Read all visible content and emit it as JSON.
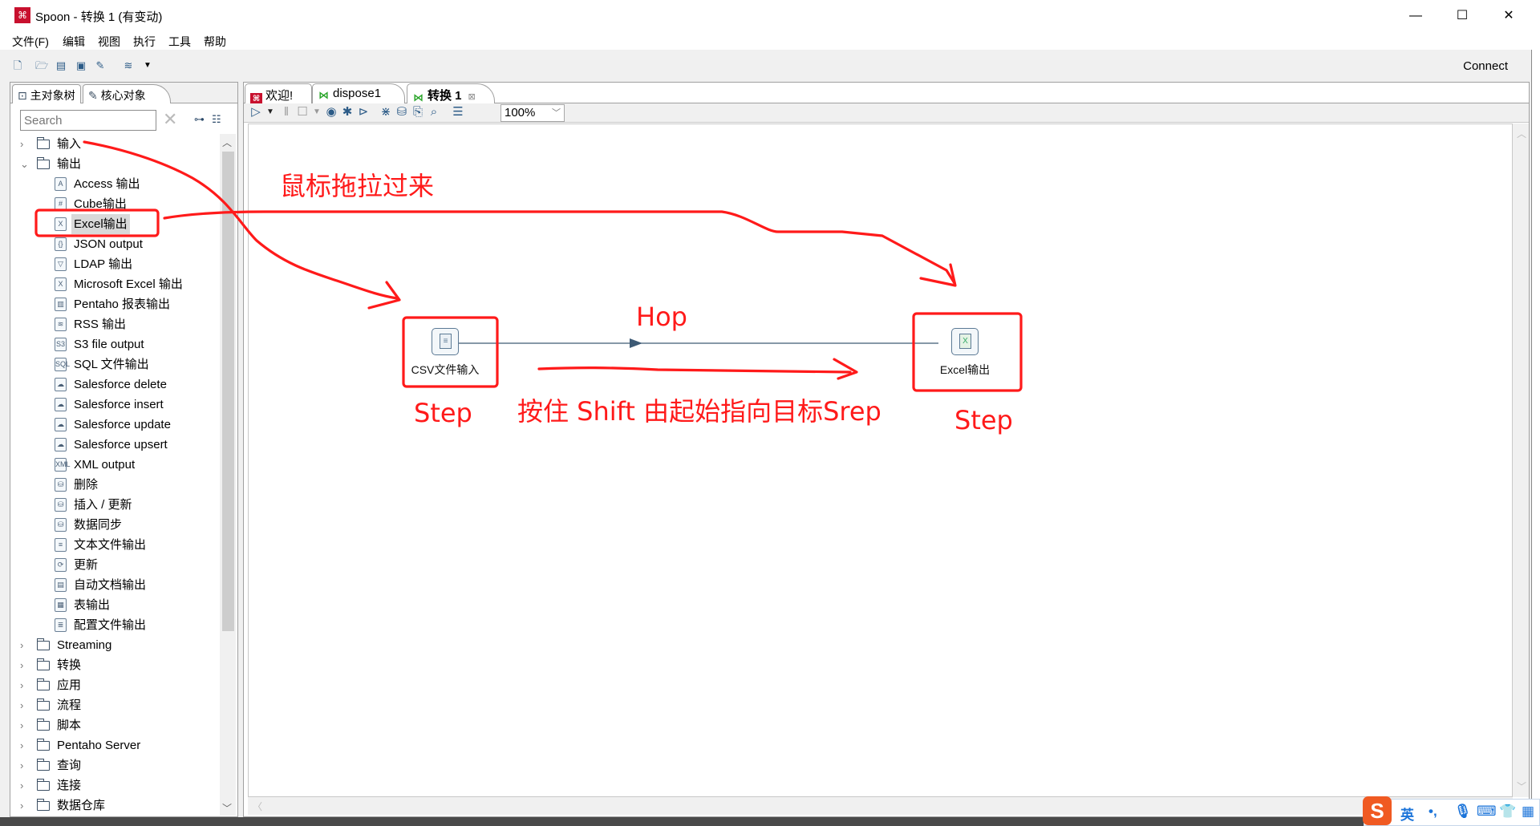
{
  "window": {
    "title": "Spoon - 转换 1 (有变动)",
    "app_icon": "spoon-logo-icon",
    "controls": {
      "minimize": "—",
      "maximize": "☐",
      "close": "✕"
    }
  },
  "menubar": {
    "items": [
      "文件(F)",
      "编辑",
      "视图",
      "执行",
      "工具",
      "帮助"
    ]
  },
  "toolbar": {
    "icons": [
      "new-file-icon",
      "open-file-icon",
      "explore-repository-icon",
      "save-icon",
      "save-as-icon",
      "perspective-layers-icon",
      "dropdown-arrow-icon"
    ],
    "connect_label": "Connect"
  },
  "left_panel": {
    "tabs": [
      {
        "label": "主对象树",
        "icon": "tree-icon",
        "active": false
      },
      {
        "label": "核心对象",
        "icon": "pencil-icon",
        "active": true
      }
    ],
    "search": {
      "placeholder": "Search",
      "value": ""
    },
    "tree": [
      {
        "label": "输入",
        "type": "folder",
        "expanded": false
      },
      {
        "label": "输出",
        "type": "folder",
        "expanded": true
      },
      {
        "label": "Access 输出",
        "type": "leaf",
        "icon": "A"
      },
      {
        "label": "Cube输出",
        "type": "leaf",
        "icon": "#"
      },
      {
        "label": "Excel输出",
        "type": "leaf",
        "icon": "X",
        "selected": true
      },
      {
        "label": "JSON output",
        "type": "leaf",
        "icon": "{}"
      },
      {
        "label": "LDAP 输出",
        "type": "leaf",
        "icon": "▽"
      },
      {
        "label": "Microsoft Excel 输出",
        "type": "leaf",
        "icon": "X"
      },
      {
        "label": "Pentaho 报表输出",
        "type": "leaf",
        "icon": "▥"
      },
      {
        "label": "RSS 输出",
        "type": "leaf",
        "icon": "≋"
      },
      {
        "label": "S3 file output",
        "type": "leaf",
        "icon": "S3"
      },
      {
        "label": "SQL 文件输出",
        "type": "leaf",
        "icon": "SQL"
      },
      {
        "label": "Salesforce delete",
        "type": "leaf",
        "icon": "☁"
      },
      {
        "label": "Salesforce insert",
        "type": "leaf",
        "icon": "☁"
      },
      {
        "label": "Salesforce update",
        "type": "leaf",
        "icon": "☁"
      },
      {
        "label": "Salesforce upsert",
        "type": "leaf",
        "icon": "☁"
      },
      {
        "label": "XML output",
        "type": "leaf",
        "icon": "XML"
      },
      {
        "label": "删除",
        "type": "leaf",
        "icon": "⛁"
      },
      {
        "label": "插入 / 更新",
        "type": "leaf",
        "icon": "⛁"
      },
      {
        "label": "数据同步",
        "type": "leaf",
        "icon": "⛁"
      },
      {
        "label": "文本文件输出",
        "type": "leaf",
        "icon": "≡"
      },
      {
        "label": "更新",
        "type": "leaf",
        "icon": "⟳"
      },
      {
        "label": "自动文档输出",
        "type": "leaf",
        "icon": "▤"
      },
      {
        "label": "表输出",
        "type": "leaf",
        "icon": "▦"
      },
      {
        "label": "配置文件输出",
        "type": "leaf",
        "icon": "≣"
      },
      {
        "label": "Streaming",
        "type": "folder",
        "expanded": false
      },
      {
        "label": "转换",
        "type": "folder",
        "expanded": false
      },
      {
        "label": "应用",
        "type": "folder",
        "expanded": false
      },
      {
        "label": "流程",
        "type": "folder",
        "expanded": false
      },
      {
        "label": "脚本",
        "type": "folder",
        "expanded": false
      },
      {
        "label": "Pentaho Server",
        "type": "folder",
        "expanded": false
      },
      {
        "label": "查询",
        "type": "folder",
        "expanded": false
      },
      {
        "label": "连接",
        "type": "folder",
        "expanded": false
      },
      {
        "label": "数据仓库",
        "type": "folder",
        "expanded": false
      }
    ]
  },
  "doc_tabs": [
    {
      "label": "欢迎!",
      "icon": "spoon-logo-icon",
      "active": false
    },
    {
      "label": "dispose1",
      "icon": "transformation-icon",
      "active": false
    },
    {
      "label": "转换 1",
      "icon": "transformation-icon",
      "active": true,
      "closable": true
    }
  ],
  "canvas_toolbar": {
    "icons": [
      "run-icon",
      "run-dropdown-icon",
      "pause-icon",
      "stop-icon",
      "stop-dropdown-icon",
      "preview-icon",
      "debug-icon",
      "replay-icon",
      "verify-icon",
      "impact-analysis-icon",
      "generate-sql-icon",
      "database-explore-icon",
      "show-results-icon"
    ],
    "zoom": "100%"
  },
  "canvas": {
    "steps": [
      {
        "id": "csv",
        "label": "CSV文件输入",
        "icon": "csv-input-icon"
      },
      {
        "id": "excel",
        "label": "Excel输出",
        "icon": "excel-output-icon"
      }
    ],
    "hops": [
      {
        "from": "csv",
        "to": "excel"
      }
    ]
  },
  "annotations": {
    "drag_text": "鼠标拖拉过来",
    "hop_text": "Hop",
    "step_left": "Step",
    "step_right": "Step",
    "shift_text": "按住 Shift 由起始指向目标Srep",
    "color": "#ff1a1a"
  },
  "ime": {
    "logo": "S",
    "lang": "英",
    "punct": "•,",
    "icons": [
      "microphone-icon",
      "keyboard-icon",
      "skin-icon",
      "toolbox-icon"
    ]
  }
}
